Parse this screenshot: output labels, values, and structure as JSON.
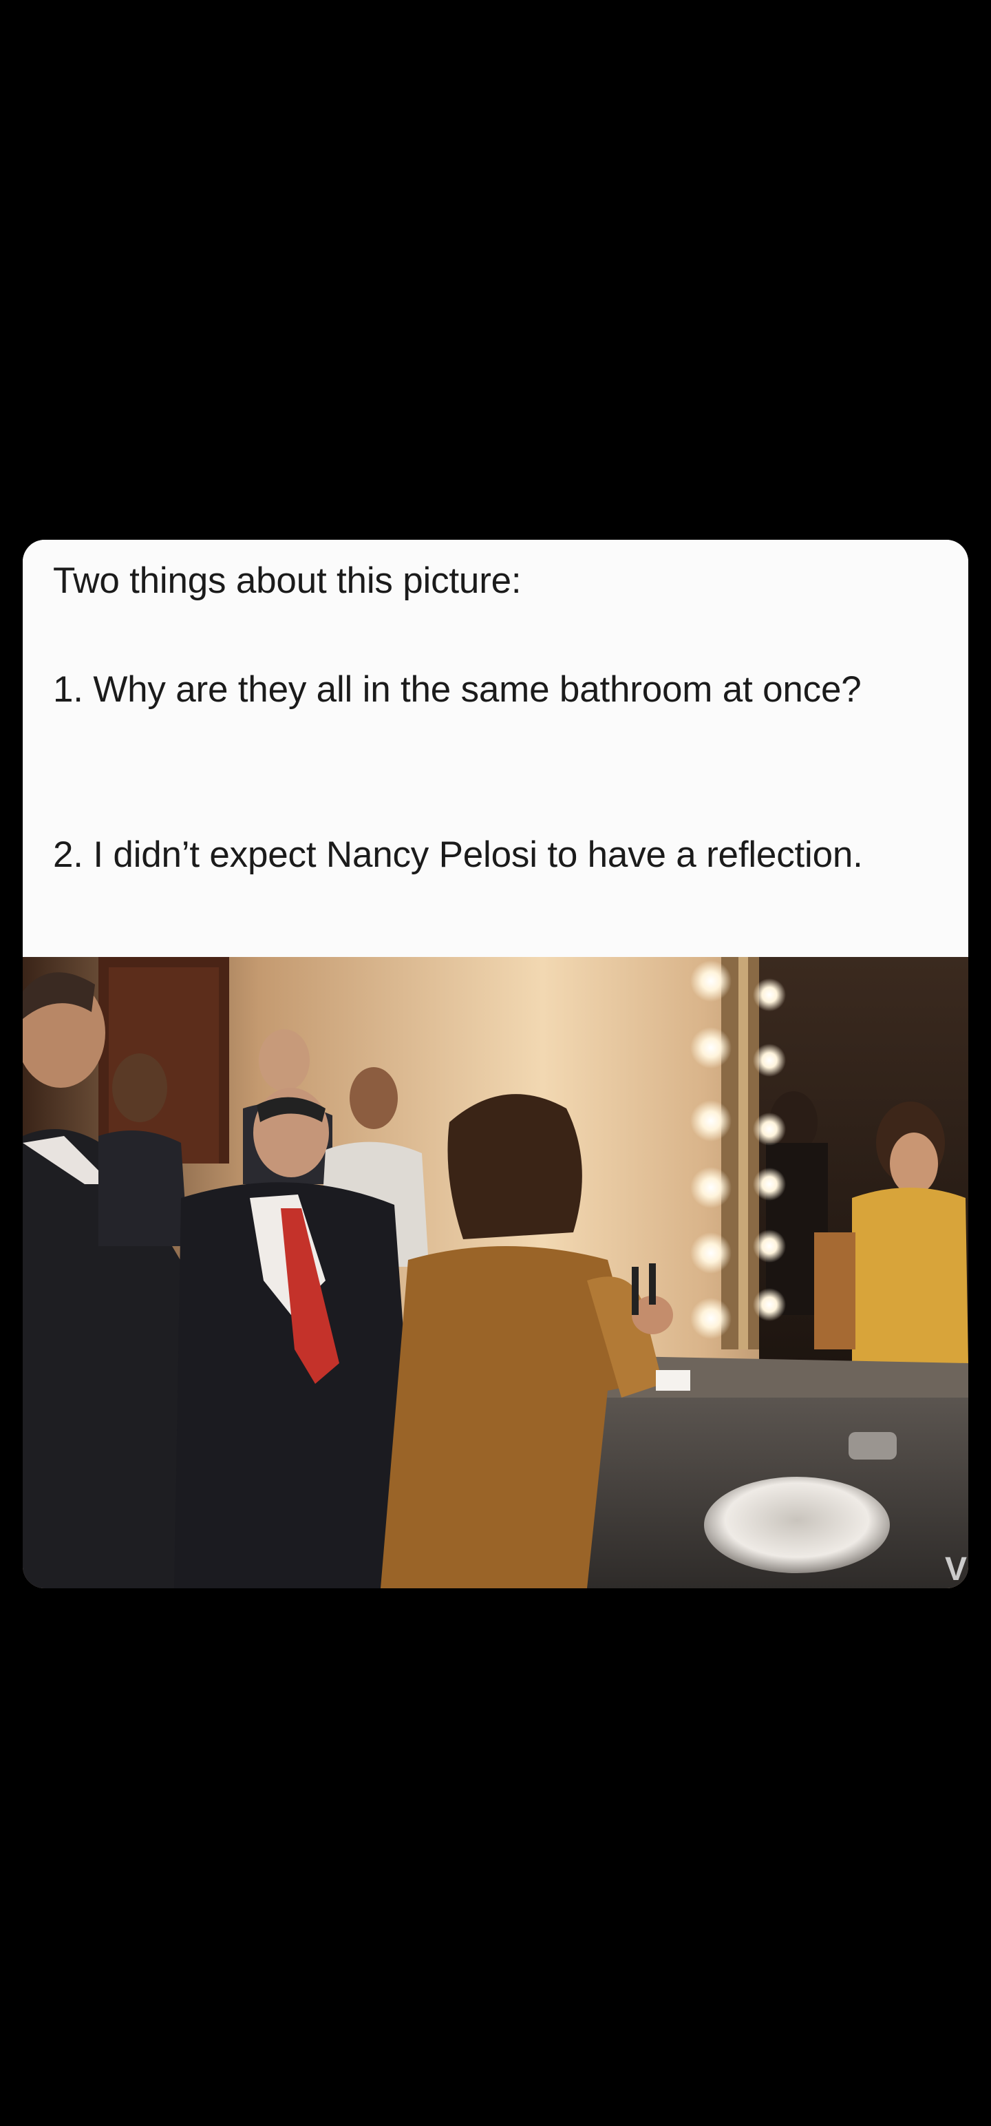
{
  "post": {
    "caption_line1": "Two things about this picture:",
    "caption_item1": "1. Why are they all in the same bathroom at once?",
    "caption_item2": "2. I didn’t expect Nancy Pelosi to have a reflection.",
    "watermark": "VI"
  },
  "colors": {
    "page_bg": "#000000",
    "card_bg": "#ffffff",
    "text": "#1b1b1b"
  }
}
